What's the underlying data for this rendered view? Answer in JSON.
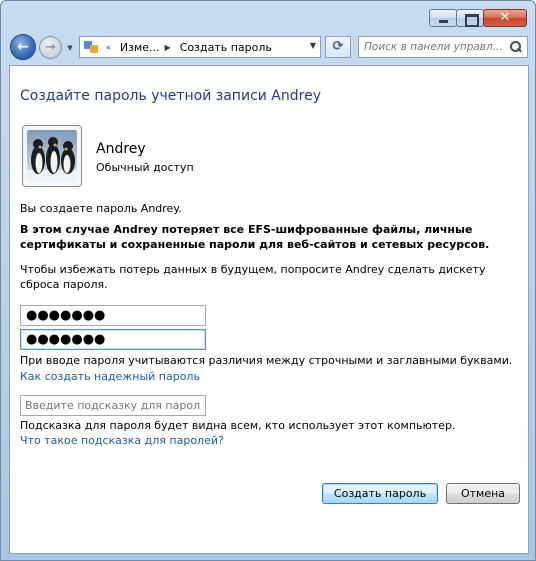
{
  "navbar": {
    "address_prefix": "Изме...",
    "address_current": "Создать пароль",
    "search_placeholder": "Поиск в панели управл..."
  },
  "page": {
    "title": "Создайте пароль учетной записи Andrey"
  },
  "user": {
    "name": "Andrey",
    "role": "Обычный доступ"
  },
  "body": {
    "intro": "Вы создаете пароль Andrey.",
    "warning": "В этом случае Andrey потеряет все EFS-шифрованные файлы, личные сертификаты и сохраненные пароли для веб-сайтов и сетевых ресурсов.",
    "advice": "Чтобы избежать потерь данных в будущем, попросите Andrey сделать дискету сброса пароля.",
    "case_note": "При вводе пароля учитываются различия между строчными и заглавными буквами.",
    "strong_password_link": "Как создать надежный пароль",
    "hint_note": "Подсказка для пароля будет видна всем, кто использует этот компьютер.",
    "hint_link": "Что такое подсказка для паролей?"
  },
  "form": {
    "password_value": "●●●●●●●",
    "confirm_value": "●●●●●●●",
    "hint_placeholder": "Введите подсказку для пароля"
  },
  "buttons": {
    "create": "Создать пароль",
    "cancel": "Отмена"
  },
  "colors": {
    "title": "#1e3a8c",
    "link": "#1b5aa8",
    "frame": "#b6cfe8"
  }
}
